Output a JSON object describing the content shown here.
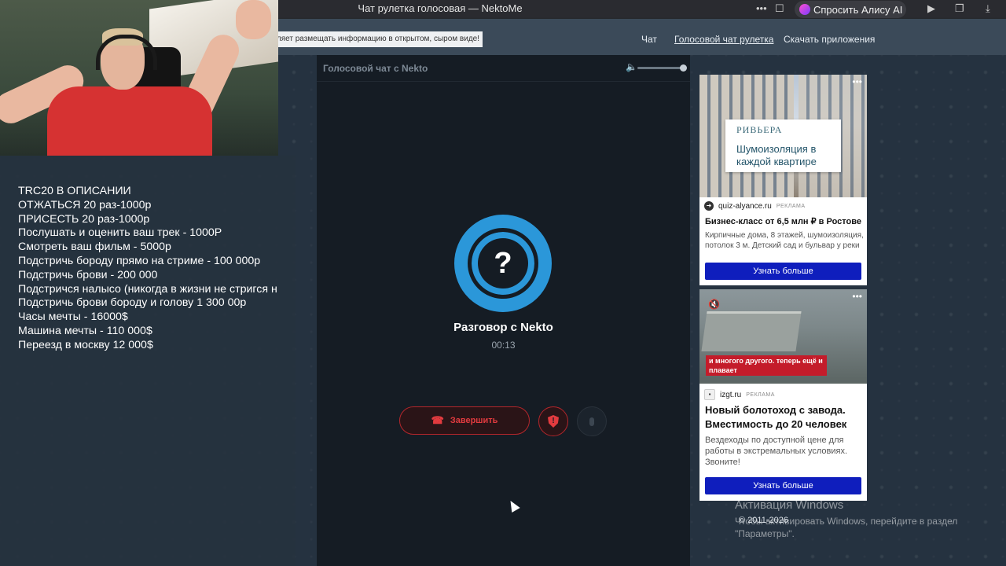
{
  "browser": {
    "window_title": "Чат рулетка голосовая — NektoMe",
    "alice_label": "Спросить Алису AI",
    "icons": [
      "more-icon",
      "bookmark-icon",
      "alice-icon",
      "play-icon",
      "collections-icon",
      "download-icon"
    ]
  },
  "nav": {
    "notice": "зволяет размещать информацию в открытом, сыром виде!",
    "links": [
      "Чат",
      "Голосовой чат рулетка",
      "Скачать приложения"
    ]
  },
  "overlay": {
    "lines": [
      "TRC20 В ОПИСАНИИ",
      "ОТЖАТЬСЯ 20 раз-1000р",
      "ПРИСЕСТЬ 20 раз-1000р",
      "Послушать и оценить ваш трек - 1000Р",
      "Смотреть ваш фильм - 5000р",
      "Подстричь бороду прямо на стриме - 100 000р",
      "Подстричь брови - 200 000",
      "Подстричся налысо (никогда в жизни не стригся н",
      "Подстричь брови бороду и голову 1 300 00р",
      "Часы мечты - 16000$",
      "Машина мечты - 110 000$",
      "Переезд в москву 12 000$"
    ]
  },
  "chat": {
    "header_title": "Голосовой чат с Nekto",
    "volume_level": 1.0,
    "avatar_symbol": "?",
    "title": "Разговор с Nekto",
    "timer": "00:13",
    "end_label": "Завершить"
  },
  "ads": [
    {
      "brand": "РИВЬЕРА",
      "slogan": "Шумоизоляция в каждой квартире",
      "domain": "quiz-alyance.ru",
      "tag": "РЕКЛАМА",
      "headline": "Бизнес-класс от 6,5 млн ₽ в Ростове",
      "body": "Кирпичные дома, 8 этажей, шумоизоляция, потолок 3 м. Детский сад и бульвар у реки",
      "button": "Узнать больше"
    },
    {
      "caption": "и многого другого. теперь ещё и плавает",
      "domain": "izgt.ru",
      "tag": "РЕКЛАМА",
      "headline": "Новый болотоход с завода. Вместимость до 20 человек",
      "body": "Вездеходы по доступной цене для работы в экстремальных условиях. Звоните!",
      "button": "Узнать больше"
    }
  ],
  "footer": {
    "windows_title": "Активация Windows",
    "windows_text": "Чтобы активировать Windows, перейдите в раздел \"Параметры\".",
    "copyright": "© 2011-2026"
  },
  "colors": {
    "accent_blue": "#2b97d9",
    "end_red": "#e23b3f",
    "ad_button": "#0f1ebd",
    "page_bg": "#26323e"
  }
}
